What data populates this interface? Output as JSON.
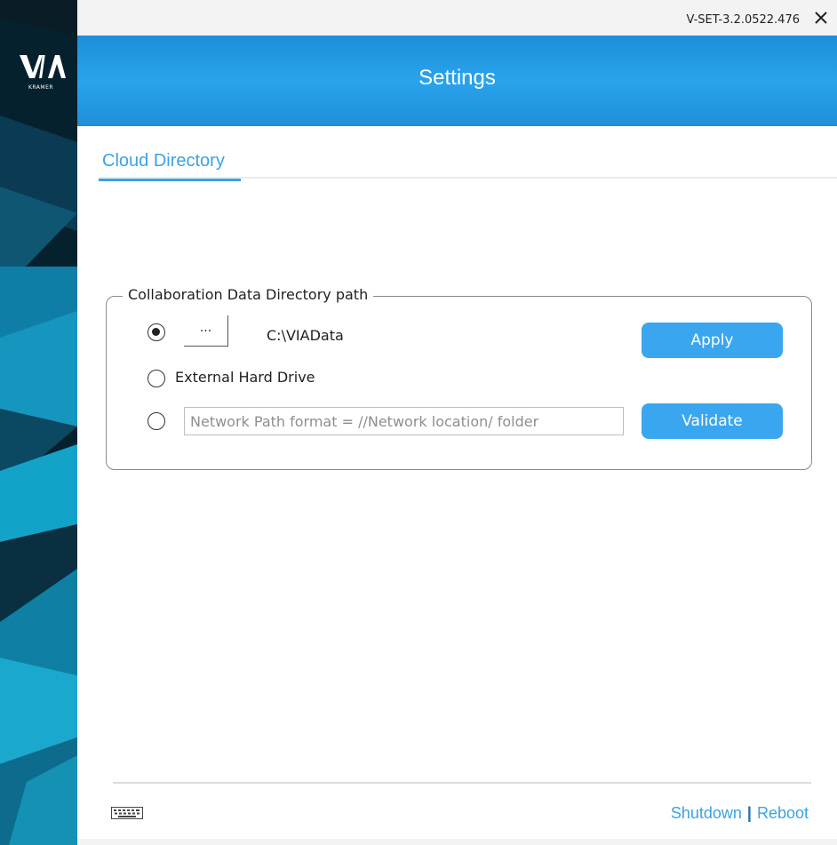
{
  "app": {
    "version": "V-SET-3.2.0522.476",
    "close_glyph": "✕",
    "logo_text": "VIA",
    "logo_subtext": "KRAMER"
  },
  "header": {
    "title": "Settings"
  },
  "tabs": [
    {
      "label": "Cloud Directory",
      "active": true
    }
  ],
  "group": {
    "legend": "Collaboration Data Directory path",
    "options": [
      {
        "id": "local",
        "selected": true,
        "browse_label": "...",
        "value": "C:\\VIAData"
      },
      {
        "id": "external",
        "selected": false,
        "label": "External Hard Drive"
      },
      {
        "id": "network",
        "selected": false,
        "input_value": "",
        "placeholder": "Network Path format = //Network location/ folder"
      }
    ],
    "apply_label": "Apply",
    "validate_label": "Validate"
  },
  "footer": {
    "keyboard_icon": "keyboard-icon",
    "shutdown_label": "Shutdown",
    "separator": "|",
    "reboot_label": "Reboot"
  },
  "colors": {
    "accent": "#3aa2e4",
    "button": "#3aa6ef",
    "header_gradient_top": "#1e8ed8",
    "header_gradient_mid": "#29a3ec",
    "rail_dark": "#06212e",
    "rail_teal": "#0f8cb0"
  }
}
